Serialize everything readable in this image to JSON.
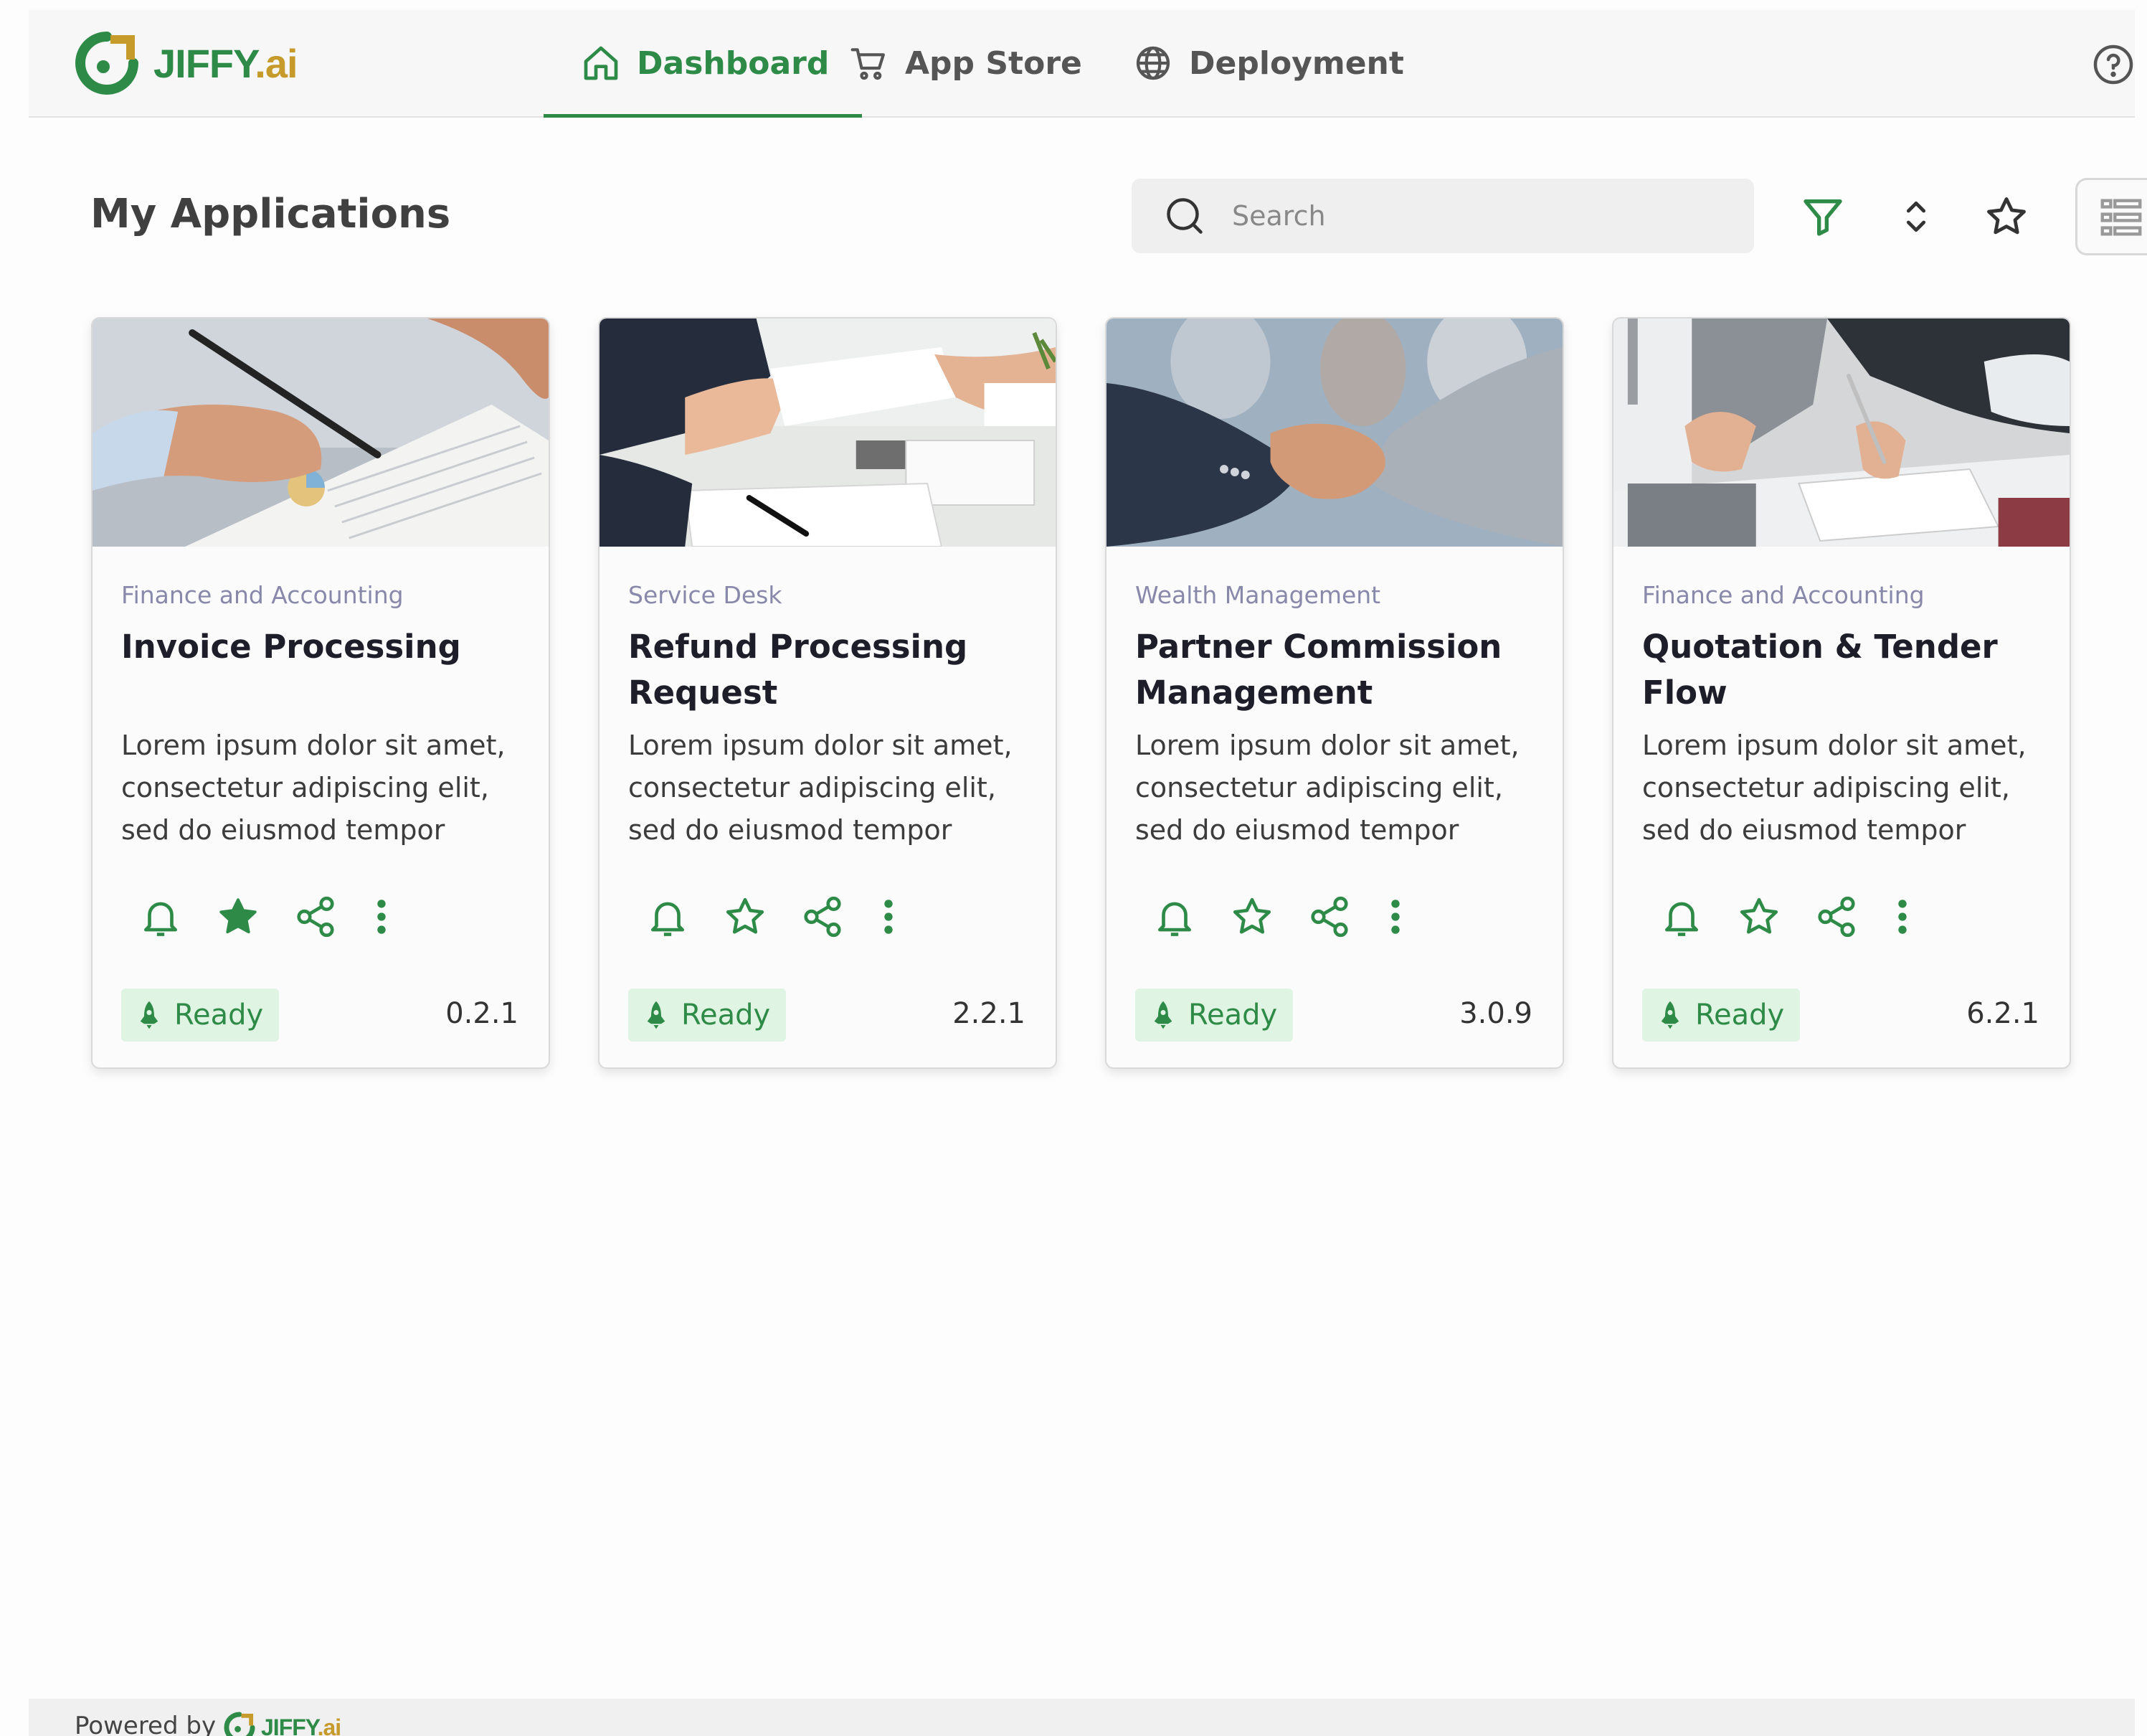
{
  "app": {
    "brand": "JIFFY",
    "brand_suffix": ".ai"
  },
  "nav": {
    "tabs": [
      {
        "label": "Dashboard",
        "icon": "home-icon",
        "active": true
      },
      {
        "label": "App Store",
        "icon": "cart-icon",
        "active": false
      },
      {
        "label": "Deployment",
        "icon": "globe-icon",
        "active": false
      }
    ],
    "help_icon": "help-icon"
  },
  "main": {
    "title": "My Applications",
    "search": {
      "placeholder": "Search",
      "value": ""
    },
    "toolbar_icons": [
      "filter-icon",
      "sort-icon",
      "favorite-icon",
      "list-view-icon"
    ]
  },
  "cards": [
    {
      "category": "Finance and Accounting",
      "title": "Invoice Processing",
      "description": "Lorem ipsum dolor sit amet, consectetur adipiscing elit, sed do eiusmod tempor",
      "favorited": true,
      "status": "Ready",
      "version": "0.2.1"
    },
    {
      "category": "Service Desk",
      "title": "Refund Processing Request",
      "description": "Lorem ipsum dolor sit amet, consectetur adipiscing elit, sed do eiusmod tempor",
      "favorited": false,
      "status": "Ready",
      "version": "2.2.1"
    },
    {
      "category": "Wealth Management",
      "title": "Partner Commission Management",
      "description": "Lorem ipsum dolor sit amet, consectetur adipiscing elit, sed do eiusmod tempor",
      "favorited": false,
      "status": "Ready",
      "version": "3.0.9"
    },
    {
      "category": "Finance and Accounting",
      "title": "Quotation & Tender Flow",
      "description": "Lorem ipsum dolor sit amet, consectetur adipiscing elit, sed do eiusmod tempor",
      "favorited": false,
      "status": "Ready",
      "version": "6.2.1"
    }
  ],
  "footer": {
    "powered_by": "Powered by",
    "brand": "JIFFY",
    "brand_suffix": ".ai"
  },
  "colors": {
    "accent": "#2e8b47",
    "brand_gold": "#c79a2c",
    "badge_bg": "#dff4e2",
    "category_text": "#8888aa"
  }
}
